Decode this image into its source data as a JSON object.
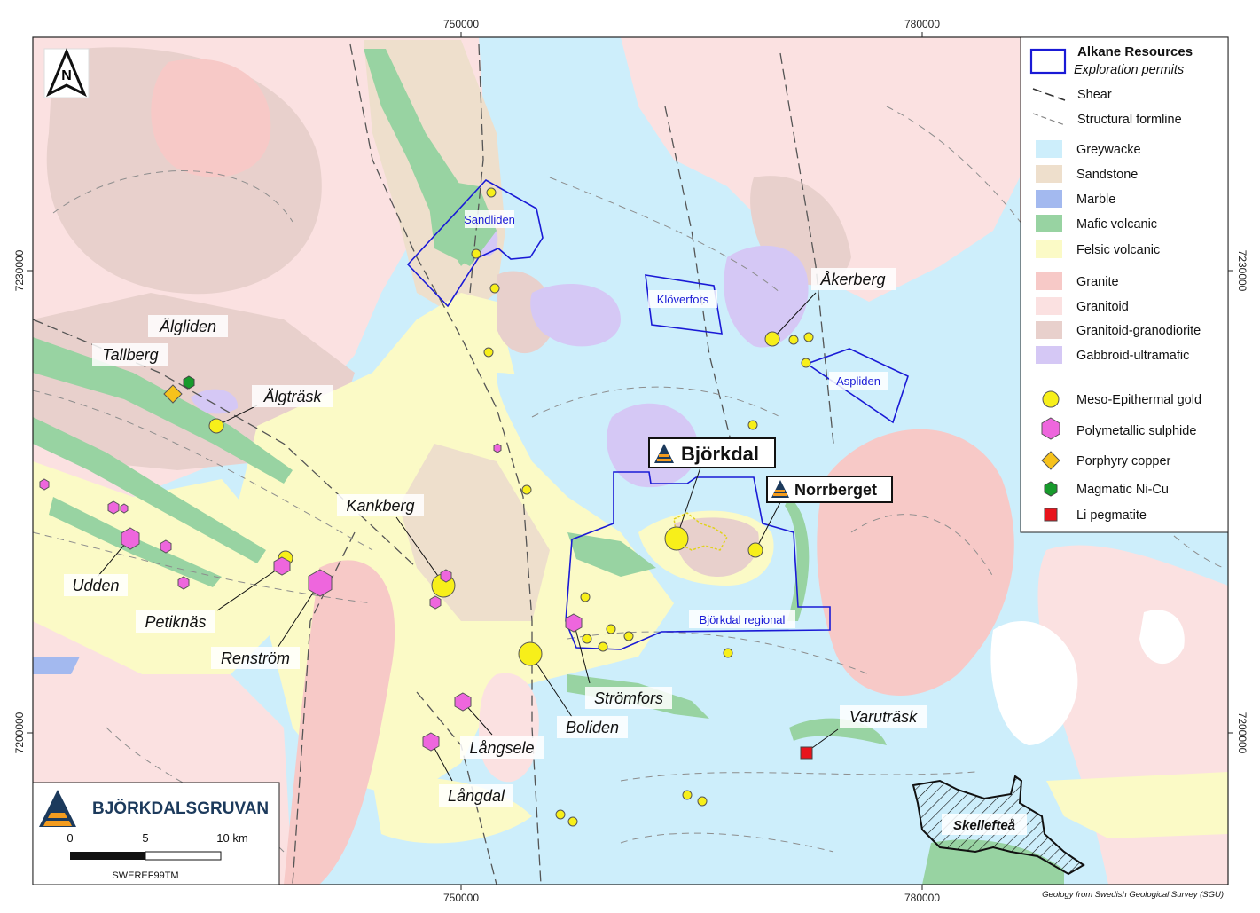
{
  "grid": {
    "eastings": [
      "750000",
      "780000"
    ],
    "northings": [
      "7230000",
      "7200000"
    ]
  },
  "north_arrow": {
    "letter": "N"
  },
  "places": {
    "algliden": "Älgliden",
    "tallberg": "Tallberg",
    "algtrask": "Älgträsk",
    "kankberg": "Kankberg",
    "udden": "Udden",
    "petiknas": "Petiknäs",
    "renstrom": "Renström",
    "langsele": "Långsele",
    "langdal": "Långdal",
    "boliden": "Boliden",
    "stromfors": "Strömfors",
    "akerberg": "Åkerberg",
    "varutrask": "Varuträsk",
    "skelleftea": "Skellefteå"
  },
  "permits": {
    "sandliden": "Sandliden",
    "kloverfors": "Klöverfors",
    "aspliden": "Aspliden",
    "bjorkdal_regional": "Björkdal regional"
  },
  "mines": {
    "bjorkdal": "Björkdal",
    "norrberget": "Norrberget"
  },
  "legend": {
    "title": "Alkane Resources",
    "subtitle": "Exploration permits",
    "shear": "Shear",
    "formline": "Structural formline",
    "units": [
      {
        "label": "Greywacke",
        "color": "#cdeefb"
      },
      {
        "label": "Sandstone",
        "color": "#eedfcc"
      },
      {
        "label": "Marble",
        "color": "#a3b9ef"
      },
      {
        "label": "Mafic volcanic",
        "color": "#98d3a2"
      },
      {
        "label": "Felsic volcanic",
        "color": "#fbfac6"
      },
      {
        "label": "Granite",
        "color": "#f7c9c7"
      },
      {
        "label": "Granitoid",
        "color": "#fbe1e1"
      },
      {
        "label": "Granitoid-granodiorite",
        "color": "#e8d0cc"
      },
      {
        "label": "Gabbroid-ultramafic",
        "color": "#d5c8f5"
      }
    ],
    "deposits": [
      {
        "label": "Meso-Epithermal gold",
        "icon": "gold-circle-icon",
        "color": "#f7ef1a"
      },
      {
        "label": "Polymetallic sulphide",
        "icon": "sulphide-hexagon-icon",
        "color": "#ee66dd"
      },
      {
        "label": "Porphyry copper",
        "icon": "copper-diamond-icon",
        "color": "#f6c21c"
      },
      {
        "label": "Magmatic Ni-Cu",
        "icon": "nicu-hexagon-icon",
        "color": "#179a2c"
      },
      {
        "label": "Li pegmatite",
        "icon": "li-square-icon",
        "color": "#e8141c"
      }
    ]
  },
  "scalebar": {
    "brand": "BJÖRKDALSGRUVAN",
    "ticks": [
      "0",
      "5",
      "10 km"
    ],
    "crs": "SWEREF99TM"
  },
  "credit": "Geology from Swedish Geological Survey (SGU)"
}
